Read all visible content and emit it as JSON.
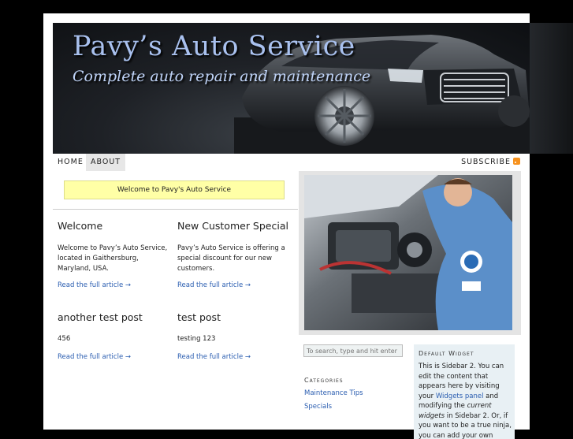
{
  "header": {
    "title": "Pavy’s Auto Service",
    "tagline": "Complete auto repair and maintenance"
  },
  "nav": {
    "items": [
      {
        "label": "HOME",
        "active": false
      },
      {
        "label": "ABOUT",
        "active": true
      }
    ],
    "subscribe_label": "SUBSCRIBE",
    "subscribe_icon": "rss-icon"
  },
  "welcome_notice": "Welcome to Pavy's Auto Service",
  "posts": [
    {
      "title": "Welcome",
      "excerpt": "Welcome to Pavy’s Auto Service, located in Gaithersburg, Maryland, USA.",
      "link": "Read the full article →"
    },
    {
      "title": "New Customer Special",
      "excerpt": "Pavy’s Auto Service is offering a special discount for our new customers.",
      "link": "Read the full article →"
    },
    {
      "title": "another test post",
      "excerpt": "456",
      "link": "Read the full article →"
    },
    {
      "title": "test post",
      "excerpt": "testing 123",
      "link": "Read the full article →"
    }
  ],
  "sidebar": {
    "search_placeholder": "To search, type and hit enter",
    "categories_title": "Categories",
    "categories": [
      "Maintenance Tips",
      "Specials"
    ],
    "widget": {
      "title": "Default Widget",
      "text_1": "This is Sidebar 2. You can edit the content that appears here by visiting your ",
      "link_1": "Widgets panel",
      "text_2": " and modifying the ",
      "em_1": "current widgets",
      "text_3": " in Sidebar 2. Or, if you want to be a true ninja, you can add your own"
    }
  },
  "colors": {
    "title": "#a9c1ef",
    "link": "#2a5db0",
    "notice_bg": "#ffffa6",
    "widget_bg": "#e8f0f4"
  }
}
